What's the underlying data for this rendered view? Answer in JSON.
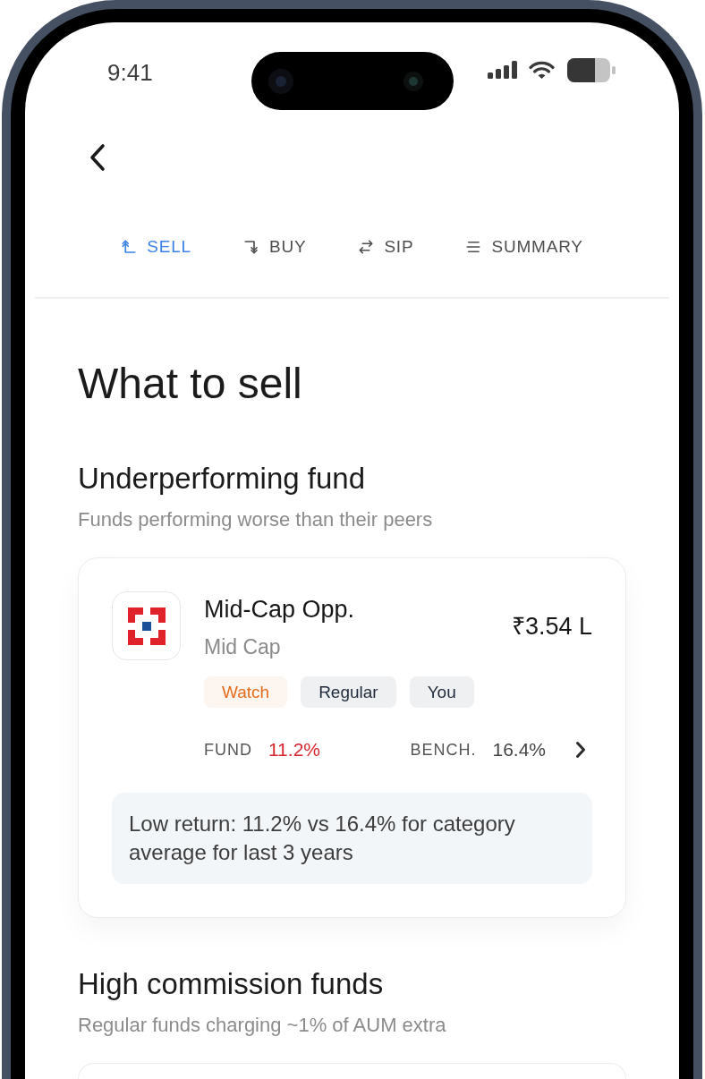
{
  "status_bar": {
    "time": "9:41"
  },
  "tabs": [
    {
      "label": "SELL",
      "selected": true
    },
    {
      "label": "BUY",
      "selected": false
    },
    {
      "label": "SIP",
      "selected": false
    },
    {
      "label": "SUMMARY",
      "selected": false
    }
  ],
  "page": {
    "title": "What to sell"
  },
  "sections": [
    {
      "title": "Underperforming fund",
      "subtitle": "Funds performing worse than their peers",
      "funds": [
        {
          "name": "Mid-Cap Opp.",
          "category": "Mid Cap",
          "amount": "₹3.54 L",
          "tags": [
            {
              "label": "Watch",
              "color": "#e46c1c"
            },
            {
              "label": "Regular",
              "color": "#1f2a3c"
            },
            {
              "label": "You",
              "color": "#1f2a3c"
            }
          ],
          "metrics": [
            {
              "label": "FUND",
              "value": "11.2%",
              "color": "#d7262d"
            },
            {
              "label": "BENCH.",
              "value": "16.4%",
              "color": "#454545"
            }
          ],
          "note": "Low return: 11.2% vs 16.4% for category average for last 3 years"
        }
      ]
    },
    {
      "title": "High commission funds",
      "subtitle": "Regular funds charging ~1% of AUM extra"
    }
  ]
}
